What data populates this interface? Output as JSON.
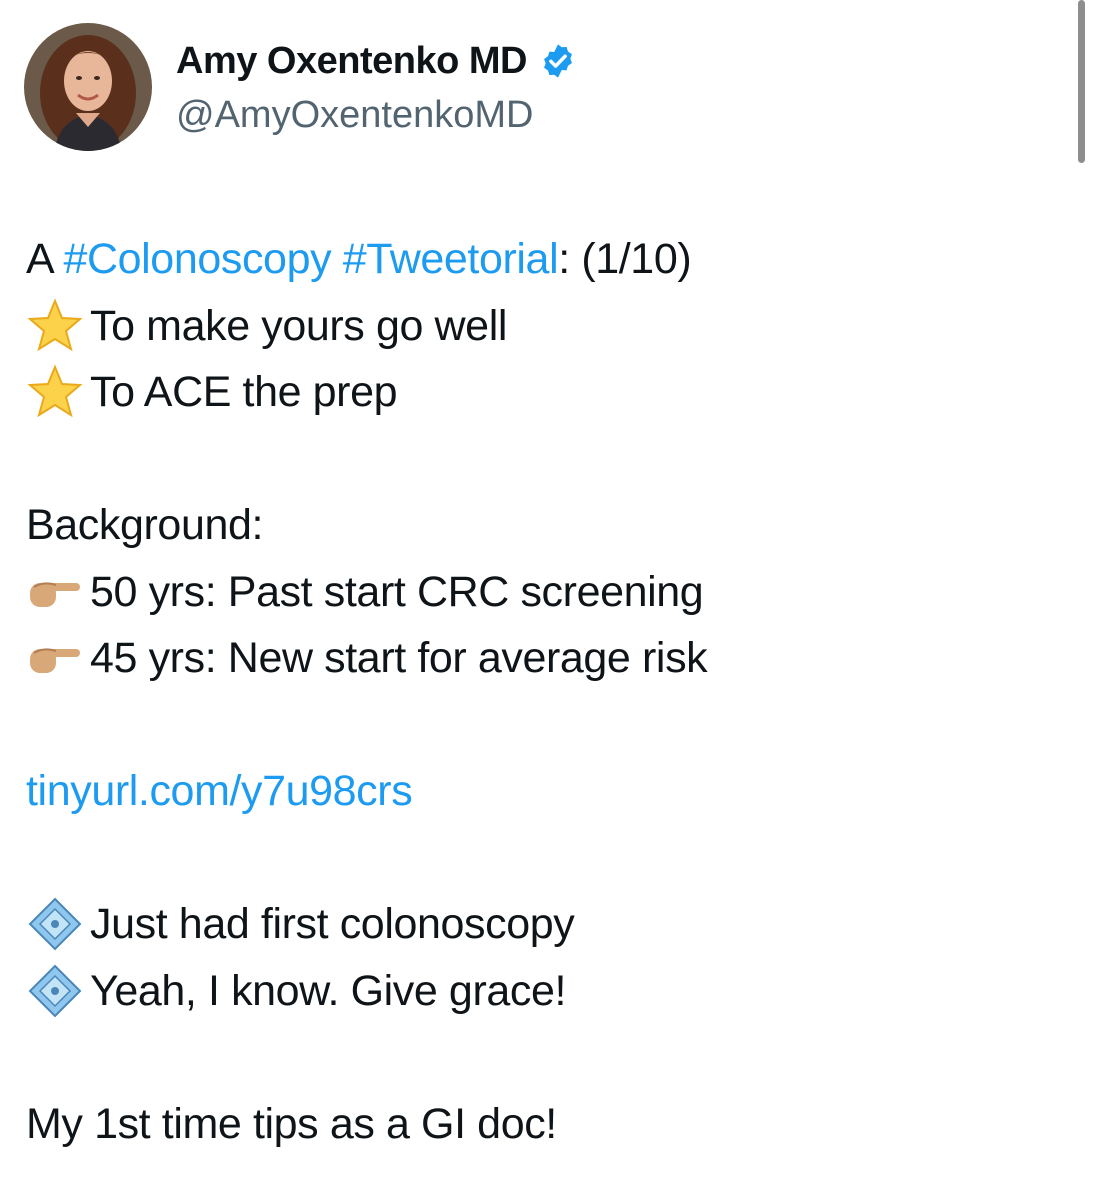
{
  "author": {
    "display_name": "Amy Oxentenko MD",
    "handle": "@AmyOxentenkoMD",
    "verified": true
  },
  "tweet": {
    "line1": {
      "prefix": "A ",
      "hashtag1": "#Colonoscopy",
      "space": " ",
      "hashtag2": "#Tweetorial",
      "suffix": ": (1/10)"
    },
    "star_items": [
      "To make yours go well",
      "To ACE the prep"
    ],
    "background_heading": "Background:",
    "pointing_items": [
      "50 yrs: Past start CRC screening",
      "45 yrs: New start for average risk"
    ],
    "link": "tinyurl.com/y7u98crs",
    "diamond_items": [
      "Just had first colonoscopy",
      "Yeah, I know. Give grace!"
    ],
    "closing": "My 1st time tips as a GI doc!"
  },
  "icons": {
    "star": "star-emoji-icon",
    "pointing": "backhand-index-pointing-right-icon",
    "diamond": "diamond-with-dot-icon",
    "verified": "verified-badge-icon"
  },
  "colors": {
    "link": "#1d9bf0",
    "handle": "#536471",
    "text": "#0f1419"
  }
}
